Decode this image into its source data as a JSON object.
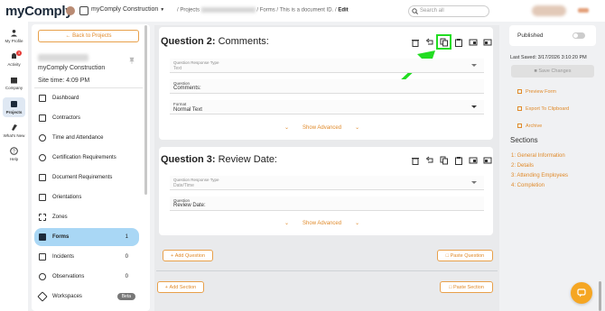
{
  "app": {
    "logo_text": "myComply",
    "org_name": "myComply Construction",
    "breadcrumbs": [
      "/ Projects",
      "/",
      "/ Forms",
      "/ This is a document ID.",
      "/",
      "Edit"
    ],
    "search_placeholder": "Search all"
  },
  "leftnav": [
    {
      "label": "My Profile",
      "icon": "person-icon"
    },
    {
      "label": "Activity",
      "icon": "bell-icon",
      "badge": "3"
    },
    {
      "label": "Company",
      "icon": "building-icon"
    },
    {
      "label": "Projects",
      "icon": "projects-icon",
      "active": true
    },
    {
      "label": "What's New",
      "icon": "rocket-icon"
    },
    {
      "label": "Help",
      "icon": "help-icon"
    }
  ],
  "sidebar": {
    "back_label": "Back to Projects",
    "org_name": "myComply Construction",
    "site_time": "Site time: 4:09 PM",
    "items": [
      {
        "label": "Dashboard",
        "icon": "dashboard-icon",
        "count": ""
      },
      {
        "label": "Contractors",
        "icon": "briefcase-icon",
        "count": ""
      },
      {
        "label": "Time and Attendance",
        "icon": "clock-icon",
        "count": ""
      },
      {
        "label": "Certification Requirements",
        "icon": "certificate-icon",
        "count": ""
      },
      {
        "label": "Document Requirements",
        "icon": "document-icon",
        "count": ""
      },
      {
        "label": "Orientations",
        "icon": "orientation-icon",
        "count": ""
      },
      {
        "label": "Zones",
        "icon": "zones-icon",
        "count": ""
      },
      {
        "label": "Forms",
        "icon": "forms-icon",
        "count": "1",
        "active": true
      },
      {
        "label": "Incidents",
        "icon": "incidents-icon",
        "count": "0"
      },
      {
        "label": "Observations",
        "icon": "observations-icon",
        "count": "0"
      },
      {
        "label": "Workspaces",
        "icon": "workspaces-icon",
        "count": "",
        "badge": "Beta"
      }
    ]
  },
  "questions": [
    {
      "title_prefix": "Question 2:",
      "title": "Comments:",
      "response_type_label": "Question Response Type",
      "response_type_value": "Text",
      "question_label": "Question",
      "question_value": "Comments:",
      "format_label": "Format",
      "format_value": "Normal Text",
      "show_advanced": "Show Advanced"
    },
    {
      "title_prefix": "Question 3:",
      "title": "Review Date:",
      "response_type_label": "Question Response Type",
      "response_type_value": "Date/Time",
      "question_label": "Question",
      "question_value": "Review Date:",
      "show_advanced": "Show Advanced"
    }
  ],
  "buttons": {
    "add_question": "Add Question",
    "paste_question": "Paste Question",
    "add_section": "Add Section",
    "paste_section": "Paste Section"
  },
  "right": {
    "published_label": "Published",
    "last_saved": "Last Saved: 3/17/2026 3:10:20 PM",
    "save_changes": "Save Changes",
    "actions": [
      "Preview Form",
      "Export To Clipboard",
      "Archive"
    ],
    "sections_title": "Sections",
    "sections": [
      "1: General Information",
      "2: Details",
      "3: Attending Employees",
      "4: Completion"
    ]
  },
  "colors": {
    "accent": "#e08a2a",
    "active_menu": "#a9d7f5",
    "highlight_green": "#22dd22"
  }
}
